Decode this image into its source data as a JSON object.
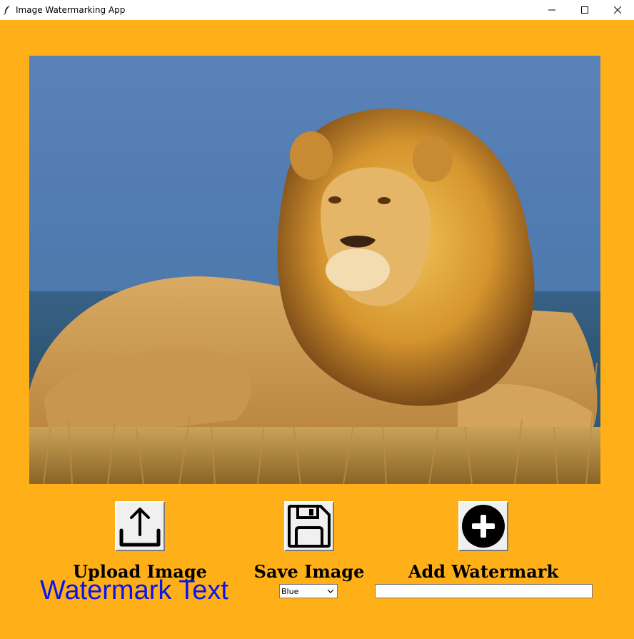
{
  "window": {
    "title": "Image Watermarking App",
    "icon": "feather-icon",
    "controls": [
      "minimize-icon",
      "maximize-icon",
      "close-icon"
    ]
  },
  "colors": {
    "background": "#ffb018",
    "watermark_label": "#0a14f0"
  },
  "image": {
    "subject": "lion lying in dry grass under a blue sky"
  },
  "buttons": {
    "upload": {
      "label": "Upload Image",
      "icon": "upload-icon"
    },
    "save": {
      "label": "Save Image",
      "icon": "floppy-disk-icon"
    },
    "add": {
      "label": "Add Watermark",
      "icon": "plus-circle-icon"
    }
  },
  "watermark": {
    "label": "Watermark Text",
    "color_select_value": "Blue",
    "text_value": ""
  }
}
